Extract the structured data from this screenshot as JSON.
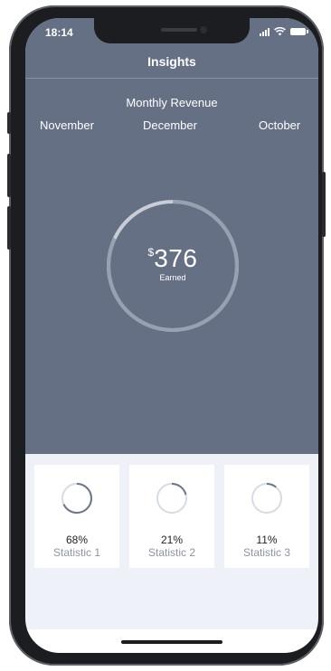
{
  "status_bar": {
    "time": "18:14"
  },
  "header": {
    "title": "Insights"
  },
  "revenue": {
    "label": "Monthly Revenue",
    "months": [
      "November",
      "December",
      "October"
    ],
    "currency": "$",
    "amount": "376",
    "caption": "Earned",
    "progress": 0.82
  },
  "stats": [
    {
      "percent": "68%",
      "label": "Statistic 1",
      "progress": 0.68
    },
    {
      "percent": "21%",
      "label": "Statistic 2",
      "progress": 0.21
    },
    {
      "percent": "11%",
      "label": "Statistic 3",
      "progress": 0.11
    }
  ],
  "colors": {
    "panel": "#667085",
    "ring_track": "#c8cdd8",
    "ring_progress": "#98a0b1",
    "stat_track": "#d7dbe3",
    "stat_progress": "#6c7488",
    "background": "#eef1f8"
  }
}
